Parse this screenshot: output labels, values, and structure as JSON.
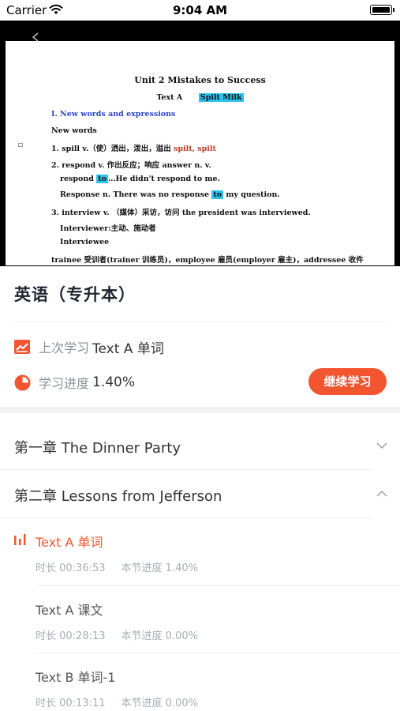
{
  "status_bar": {
    "carrier": "Carrier",
    "time": "9:04 AM"
  },
  "video": {
    "slide": {
      "title": "Unit 2 Mistakes to Success",
      "subtitle_text": "Text A",
      "subtitle_highlight": "Spilt Milk",
      "section_heading": "I. New words and expressions",
      "new_words": "New words",
      "line1_a": "1. spill v.（使）洒出，泼出，溢出 ",
      "line1_b": "spilt, spilt",
      "line2": "2. respond v. 作出反应；响应  answer n. v.",
      "line3_a": "respond ",
      "line3_b": "to",
      "line3_c": "…He didn't respond to me.",
      "line4_a": "Response n. There was no response ",
      "line4_b": "to",
      "line4_c": " my question.",
      "line5": "3.  interview v. （媒体）采访，访问  the president was interviewed.",
      "line6": "Interviewer:主动、施动者",
      "line7": "Interviewee",
      "line8": "trainee 受训者(trainer 训练员)，employee 雇员(employer 雇主)，addressee 收件"
    }
  },
  "course": {
    "title": "英语（专升本）",
    "last_study_label": "上次学习",
    "last_study_value": "Text A 单词",
    "progress_label": "学习进度",
    "progress_value": "1.40%",
    "progress_fraction": 0.014,
    "continue_button": "继续学习"
  },
  "chapters": [
    {
      "title": "第一章 The Dinner Party",
      "expanded": false
    },
    {
      "title": "第二章 Lessons from Jefferson",
      "expanded": true
    }
  ],
  "lessons": [
    {
      "title": "Text A 单词",
      "duration": "时长 00:36:53",
      "progress": "本节进度 1.40%",
      "active": true
    },
    {
      "title": "Text A  课文",
      "duration": "时长 00:28:13",
      "progress": "本节进度 0.00%",
      "active": false
    },
    {
      "title": "Text B  单词-1",
      "duration": "时长 00:13:11",
      "progress": "本节进度 0.00%",
      "active": false
    }
  ],
  "colors": {
    "accent": "#f2552f",
    "highlight": "#2dc3f0",
    "heading_blue": "#2c46c8"
  },
  "icons": {
    "last_study": "trend-chart-icon",
    "progress": "pie-progress-icon",
    "playing": "audio-bars-icon",
    "collapse": "chevron-down-icon",
    "expand": "chevron-up-icon"
  }
}
